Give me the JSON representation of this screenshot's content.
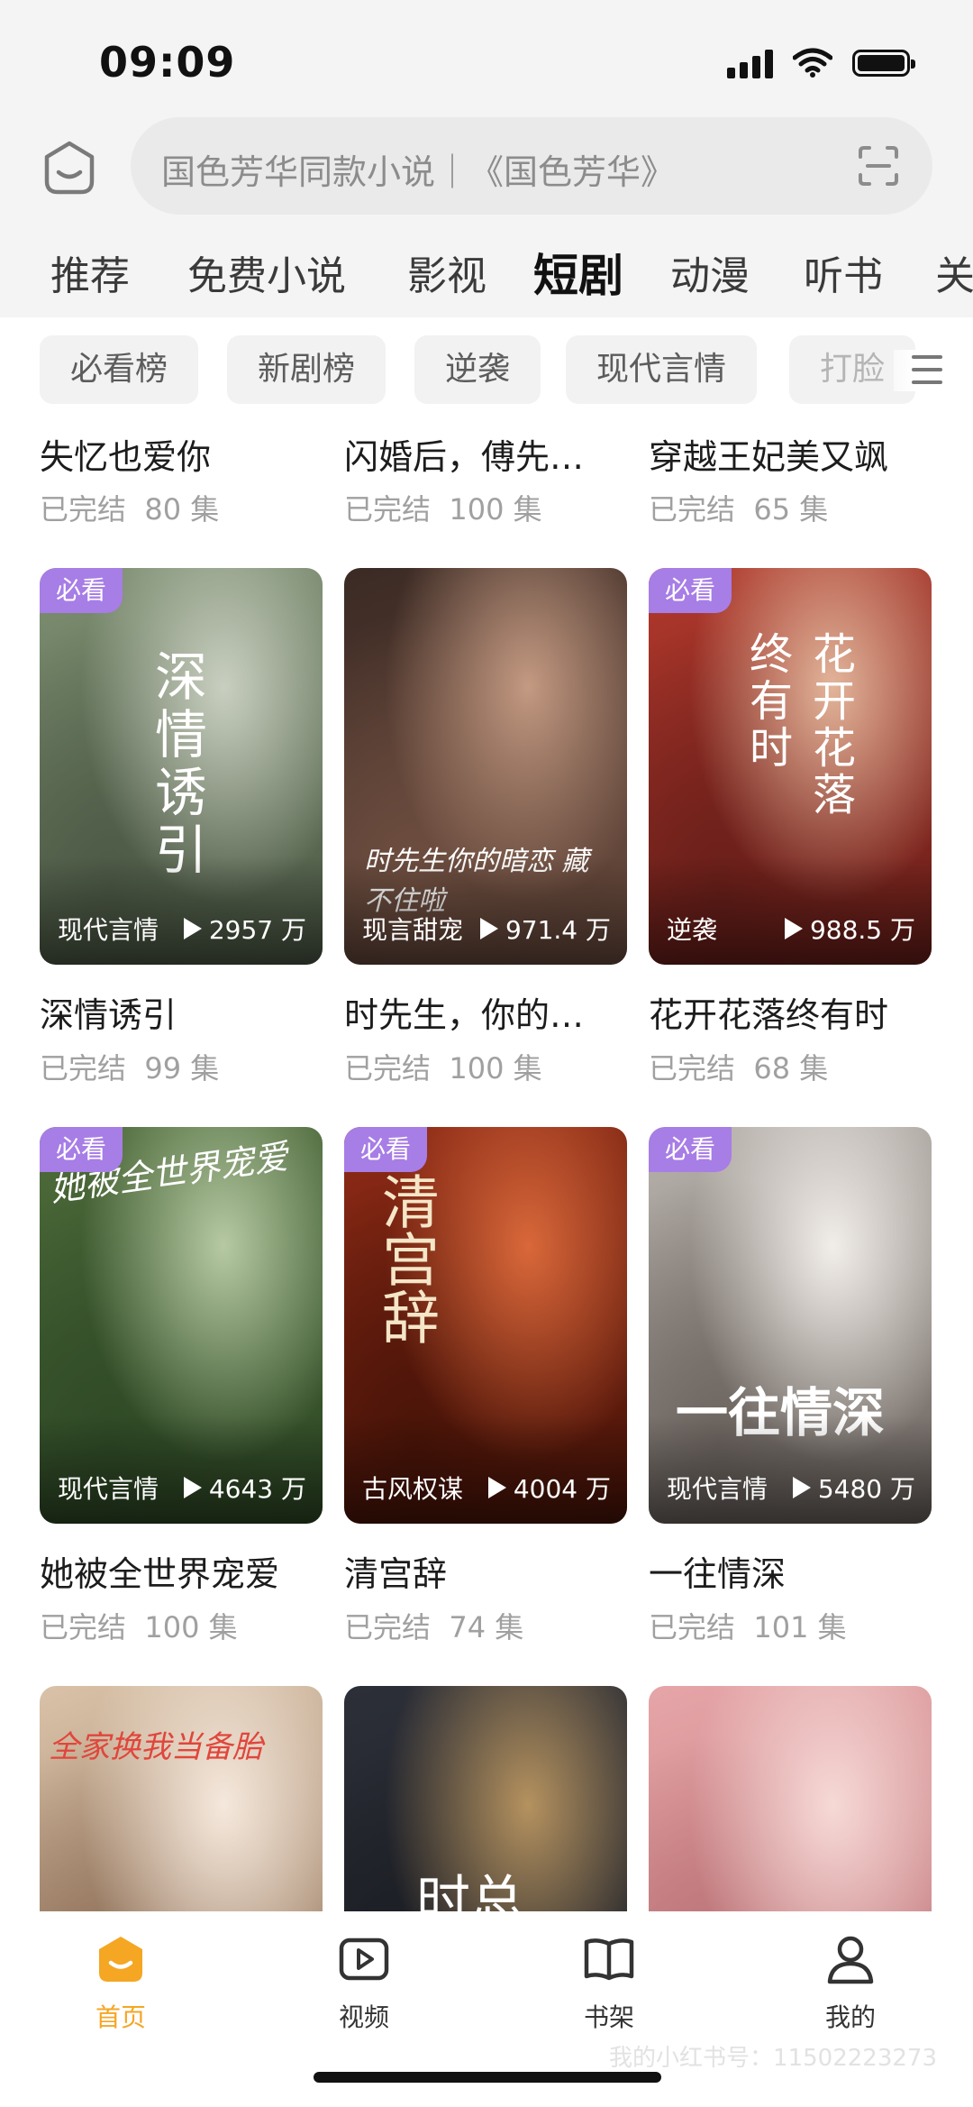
{
  "status": {
    "time": "09:09"
  },
  "search": {
    "placeholder": "国色芳华同款小说｜《国色芳华》"
  },
  "tabs": [
    {
      "label": "推荐"
    },
    {
      "label": "免费小说"
    },
    {
      "label": "影视"
    },
    {
      "label": "短剧",
      "active": true
    },
    {
      "label": "动漫"
    },
    {
      "label": "听书"
    },
    {
      "label": "关"
    }
  ],
  "chips": [
    {
      "label": "必看榜"
    },
    {
      "label": "新剧榜"
    },
    {
      "label": "逆袭"
    },
    {
      "label": "现代言情"
    },
    {
      "label": "打脸"
    }
  ],
  "top_row": [
    {
      "title": "失忆也爱你",
      "status": "已完结",
      "episodes": "80 集"
    },
    {
      "title": "闪婚后，傅先…",
      "status": "已完结",
      "episodes": "100 集"
    },
    {
      "title": "穿越王妃美又飒",
      "status": "已完结",
      "episodes": "65 集"
    }
  ],
  "grid": [
    {
      "badge": "必看",
      "genre": "现代言情",
      "plays": "2957 万",
      "title": "深情诱引",
      "status": "已完结",
      "episodes": "99 集",
      "poster_text": "深情诱引",
      "colors": [
        "#7d8f71",
        "#c9cfc0",
        "#4d5a46"
      ]
    },
    {
      "badge": "",
      "genre": "现言甜宠",
      "plays": "971.4 万",
      "title": "时先生，你的…",
      "status": "已完结",
      "episodes": "100 集",
      "poster_text": "时先生你的暗恋 藏不住啦",
      "colors": [
        "#3b2a24",
        "#c49a82",
        "#6e4e40"
      ]
    },
    {
      "badge": "必看",
      "genre": "逆袭",
      "plays": "988.5 万",
      "title": "花开花落终有时",
      "status": "已完结",
      "episodes": "68 集",
      "poster_text": "花开花落 终有时",
      "colors": [
        "#b1382c",
        "#e2b59a",
        "#6b1f1a"
      ]
    },
    {
      "badge": "必看",
      "genre": "现代言情",
      "plays": "4643 万",
      "title": "她被全世界宠爱",
      "status": "已完结",
      "episodes": "100 集",
      "poster_text": "她被全世界宠爱",
      "colors": [
        "#4d6b3a",
        "#b6c9a2",
        "#2f4a26"
      ]
    },
    {
      "badge": "必看",
      "genre": "古风权谋",
      "plays": "4004 万",
      "title": "清宫辞",
      "status": "已完结",
      "episodes": "74 集",
      "poster_text": "清宫辞",
      "colors": [
        "#8e2a16",
        "#d9683a",
        "#4a1408"
      ]
    },
    {
      "badge": "必看",
      "genre": "现代言情",
      "plays": "5480 万",
      "title": "一往情深",
      "status": "已完结",
      "episodes": "101 集",
      "poster_text": "一往情深",
      "colors": [
        "#b8b2ad",
        "#f1ede8",
        "#6d6560"
      ]
    },
    {
      "badge": "",
      "genre": "",
      "plays": "",
      "title": "",
      "status": "",
      "episodes": "",
      "poster_text": "全家换我当备胎",
      "colors": [
        "#d9c2a8",
        "#f5e8dc",
        "#8c6d55"
      ]
    },
    {
      "badge": "",
      "genre": "",
      "plays": "",
      "title": "",
      "status": "",
      "episodes": "",
      "poster_text": "时总",
      "colors": [
        "#2c2f38",
        "#b5925f",
        "#1a1c22"
      ]
    },
    {
      "badge": "",
      "genre": "",
      "plays": "",
      "title": "",
      "status": "",
      "episodes": "",
      "poster_text": "",
      "colors": [
        "#e6a5a8",
        "#f6d9d6",
        "#b87074"
      ]
    }
  ],
  "bottom_nav": [
    {
      "label": "首页",
      "icon": "home-icon",
      "active": true
    },
    {
      "label": "视频",
      "icon": "video-icon"
    },
    {
      "label": "书架",
      "icon": "bookshelf-icon"
    },
    {
      "label": "我的",
      "icon": "profile-icon"
    }
  ],
  "watermark": "我的小红书号：11502223273",
  "colors": {
    "accent": "#f5a623",
    "badge": "#a77de6",
    "muted": "#a0a0a0"
  }
}
